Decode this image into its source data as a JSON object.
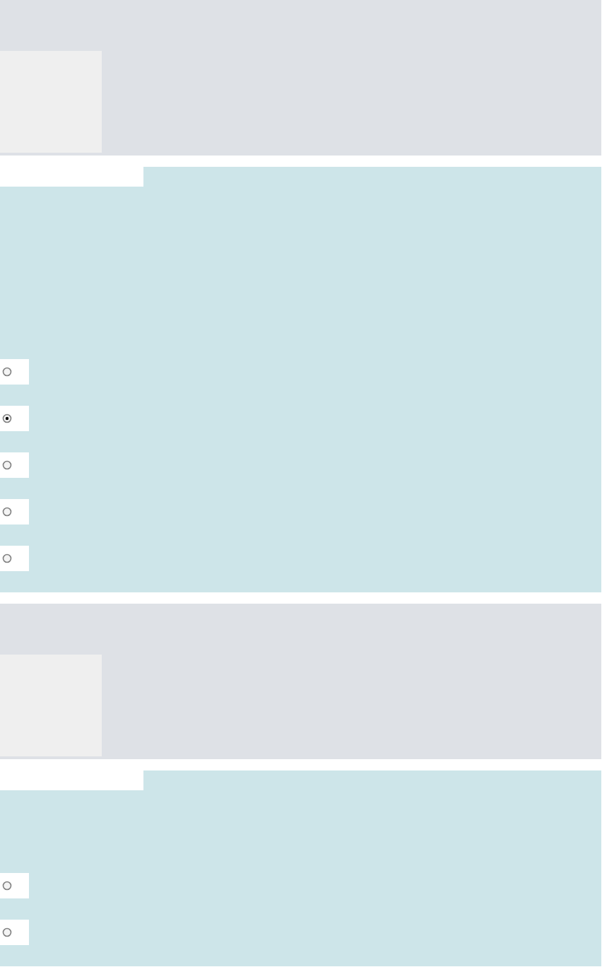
{
  "sections": [
    {
      "options": [
        {
          "selected": false
        },
        {
          "selected": true
        },
        {
          "selected": false
        },
        {
          "selected": false
        },
        {
          "selected": false
        }
      ]
    },
    {
      "options": [
        {
          "selected": false
        },
        {
          "selected": false
        }
      ]
    }
  ]
}
